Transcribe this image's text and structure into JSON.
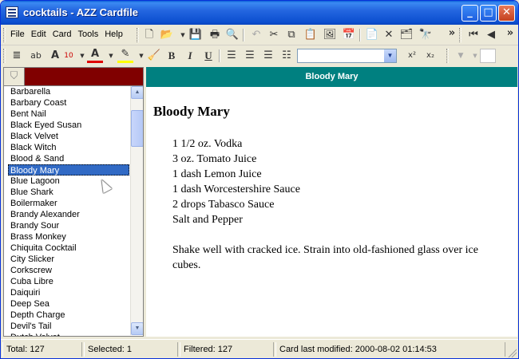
{
  "window": {
    "title": "cocktails - AZZ Cardfile",
    "minimize_glyph": "_",
    "maximize_glyph": "□",
    "close_glyph": "✕"
  },
  "menu": {
    "items": [
      "File",
      "Edit",
      "Card",
      "Tools",
      "Help"
    ]
  },
  "toolbar": {
    "icons": [
      "new-icon",
      "open-icon",
      "save-icon",
      "print-icon",
      "print-preview-icon",
      "undo-icon",
      "cut-icon",
      "copy-icon",
      "paste-icon",
      "insert-picture-icon",
      "insert-date-icon",
      "new-card-icon",
      "delete-card-icon",
      "properties-icon",
      "find-icon",
      "first-card-icon",
      "previous-card-icon"
    ],
    "font_size": "10",
    "font_name": "",
    "bold": "B",
    "italic": "I",
    "underline": "U",
    "superscript": "x²",
    "subscript": "x₂",
    "overflow": "»"
  },
  "list": {
    "items": [
      "Barbarella",
      "Barbary Coast",
      "Bent Nail",
      "Black Eyed Susan",
      "Black Velvet",
      "Black Witch",
      "Blood & Sand",
      "Bloody Mary",
      "Blue Lagoon",
      "Blue Shark",
      "Boilermaker",
      "Brandy Alexander",
      "Brandy Sour",
      "Brass Monkey",
      "Chiquita Cocktail",
      "City Slicker",
      "Corkscrew",
      "Cuba Libre",
      "Daiquiri",
      "Deep Sea",
      "Depth Charge",
      "Devil's Tail",
      "Dutch Velvet"
    ],
    "selected": "Bloody Mary"
  },
  "card": {
    "header": "Bloody Mary",
    "title": "Bloody Mary",
    "ingredients": [
      "1 1/2 oz. Vodka",
      "3 oz. Tomato Juice",
      "1 dash Lemon Juice",
      "1 dash Worcestershire Sauce",
      "2 drops Tabasco Sauce",
      "Salt and Pepper"
    ],
    "instructions": "Shake well with cracked ice. Strain into old-fashioned glass over ice cubes."
  },
  "status": {
    "total": "Total: 127",
    "selected": "Selected: 1",
    "filtered": "Filtered: 127",
    "modified": "Card last modified: 2000-08-02  01:14:53"
  },
  "colors": {
    "card_header": "#008080",
    "filter_bar": "#800000",
    "selection": "#316ac5"
  }
}
